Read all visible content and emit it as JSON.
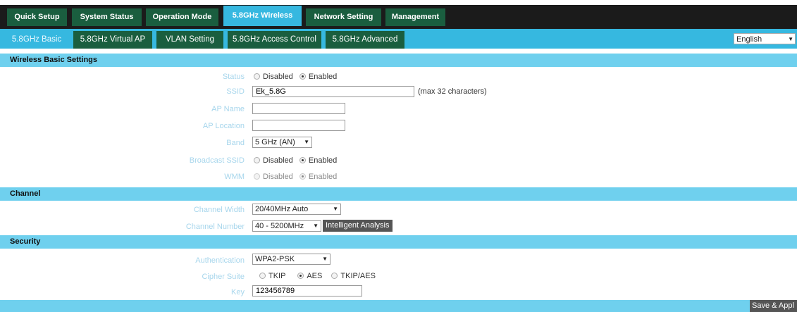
{
  "top_tabs": [
    "Quick Setup",
    "System Status",
    "Operation Mode",
    "5.8GHz Wireless",
    "Network Setting",
    "Management"
  ],
  "sub_tabs": [
    "5.8GHz Basic",
    "5.8GHz Virtual AP",
    "VLAN Setting",
    "5.8GHz Access Control",
    "5.8GHz Advanced"
  ],
  "language": "English",
  "sections": {
    "basic": "Wireless Basic Settings",
    "channel": "Channel",
    "security": "Security"
  },
  "basic": {
    "status_label": "Status",
    "ssid_label": "SSID",
    "ssid_value": "Ek_5.8G",
    "ssid_hint": "(max 32 characters)",
    "ap_name_label": "AP Name",
    "ap_name_value": "",
    "ap_location_label": "AP Location",
    "ap_location_value": "",
    "band_label": "Band",
    "band_value": "5 GHz (AN)",
    "broadcast_label": "Broadcast SSID",
    "wmm_label": "WMM",
    "disabled": "Disabled",
    "enabled": "Enabled"
  },
  "channel": {
    "width_label": "Channel Width",
    "width_value": "20/40MHz Auto",
    "number_label": "Channel Number",
    "number_value": "40 - 5200MHz",
    "analysis_button": "Intelligent Analysis"
  },
  "security": {
    "auth_label": "Authentication",
    "auth_value": "WPA2-PSK",
    "cipher_label": "Cipher Suite",
    "cipher_options": [
      "TKIP",
      "AES",
      "TKIP/AES"
    ],
    "key_label": "Key",
    "key_value": "123456789"
  },
  "save_button": "Save & Appl",
  "colors": {
    "accent": "#36b8e0",
    "tab_green": "#1a5e3f",
    "section_blue": "#6fd0ee"
  }
}
